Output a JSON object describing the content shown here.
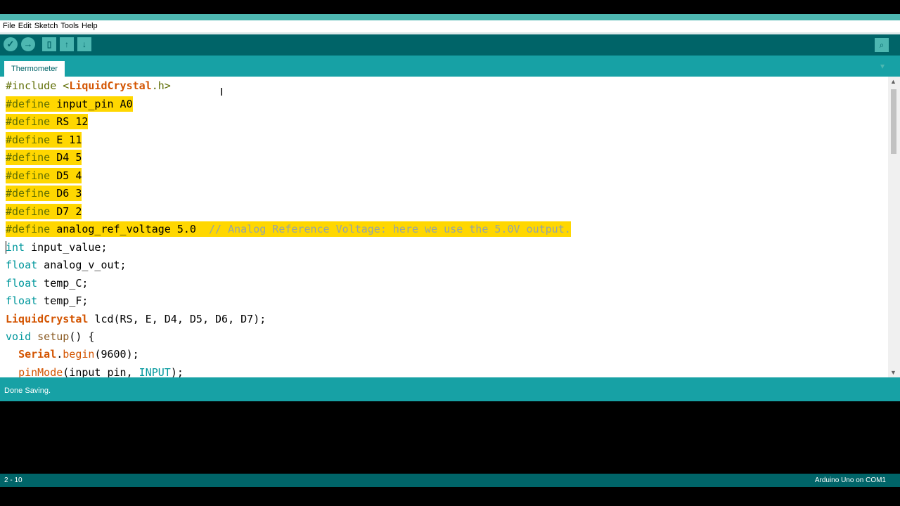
{
  "menu": [
    "File",
    "Edit",
    "Sketch",
    "Tools",
    "Help"
  ],
  "toolbar": {
    "verify_icon": "✓",
    "upload_icon": "→",
    "new_icon": "▯",
    "open_icon": "↑",
    "save_icon": "↓",
    "serial_icon": "⌕"
  },
  "tab": {
    "name": "Thermometer",
    "menu_icon": "▾"
  },
  "code": {
    "l0": {
      "a": "#include <",
      "b": "LiquidCrystal",
      "c": ".h>"
    },
    "l1": {
      "a": "#define ",
      "b": "input_pin A0"
    },
    "l2": {
      "a": "#define ",
      "b": "RS 12"
    },
    "l3": {
      "a": "#define ",
      "b": "E 11"
    },
    "l4": {
      "a": "#define ",
      "b": "D4 5"
    },
    "l5": {
      "a": "#define ",
      "b": "D5 4"
    },
    "l6": {
      "a": "#define ",
      "b": "D6 3"
    },
    "l7": {
      "a": "#define ",
      "b": "D7 2"
    },
    "l8": {
      "a": "#define ",
      "b": "analog_ref_voltage 5.0  ",
      "c": "// Analog Reference Voltage: here we use the 5.0V output."
    },
    "l9": {
      "a": "int",
      "b": " input_value;"
    },
    "l10": {
      "a": "float",
      "b": " analog_v_out;"
    },
    "l11": {
      "a": "float",
      "b": " temp_C;"
    },
    "l12": {
      "a": "float",
      "b": " temp_F;"
    },
    "l13": {
      "a": "LiquidCrystal",
      "b": " lcd(RS, E, D4, D5, D6, D7);"
    },
    "l14": {
      "a": "void",
      "b": " ",
      "c": "setup",
      "d": "() {"
    },
    "l15": {
      "a": "  ",
      "b": "Serial",
      "c": ".",
      "d": "begin",
      "e": "(9600);"
    },
    "l16": {
      "a": "  ",
      "b": "pinMode",
      "c": "(input_pin, ",
      "d": "INPUT",
      "e": ");"
    }
  },
  "status": "Done Saving.",
  "footer": {
    "line": "2 - 10",
    "board": "Arduino Uno on COM1"
  },
  "colors": {
    "toolbar": "#006468",
    "tabbar": "#17a1a5",
    "highlight": "#ffd700"
  }
}
